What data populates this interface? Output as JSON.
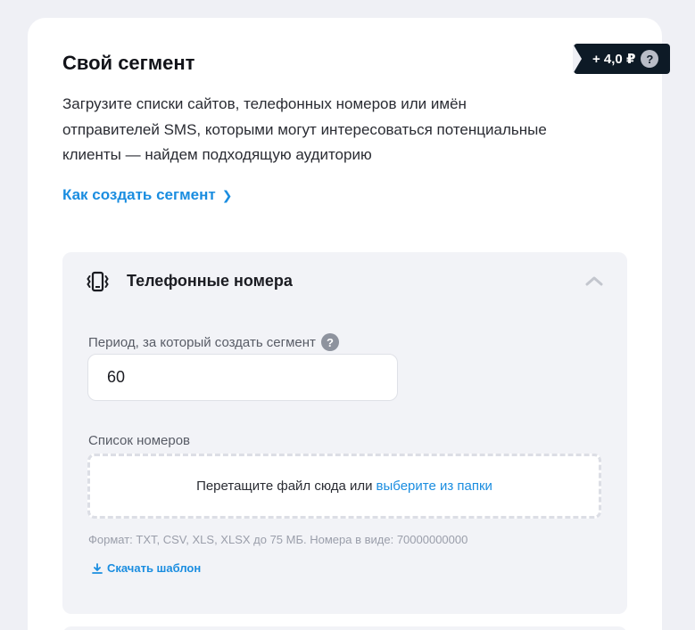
{
  "price": {
    "value": "+ 4,0 ₽",
    "help_glyph": "?"
  },
  "segment": {
    "title": "Свой сегмент",
    "description": "Загрузите списки сайтов, телефонных номеров или имён отправителей SMS, которыми могут интересоваться потенциальные клиенты — найдем подходящую аудиторию",
    "how_link": "Как создать сегмент",
    "how_link_arrow": "❯"
  },
  "panel": {
    "title": "Телефонные номера",
    "period_label": "Период, за который создать сегмент",
    "period_help_glyph": "?",
    "period_value": "60",
    "numbers_label": "Список номеров",
    "dropzone_text": "Перетащите файл сюда или",
    "dropzone_link": "выберите из папки",
    "format_note": "Формат: TXT, CSV, XLS, XLSX до 75 МБ. Номера в виде: 70000000000",
    "download_template": "Скачать шаблон"
  },
  "colors": {
    "accent": "#1a8de0",
    "badge_bg": "#0d1a26",
    "page_bg": "#eff0f5",
    "panel_bg": "#f2f3f7"
  },
  "icons": {
    "panel_icon": "phone-icon",
    "collapse": "chevron-up-icon",
    "download": "download-icon",
    "help": "question-circle-icon"
  }
}
